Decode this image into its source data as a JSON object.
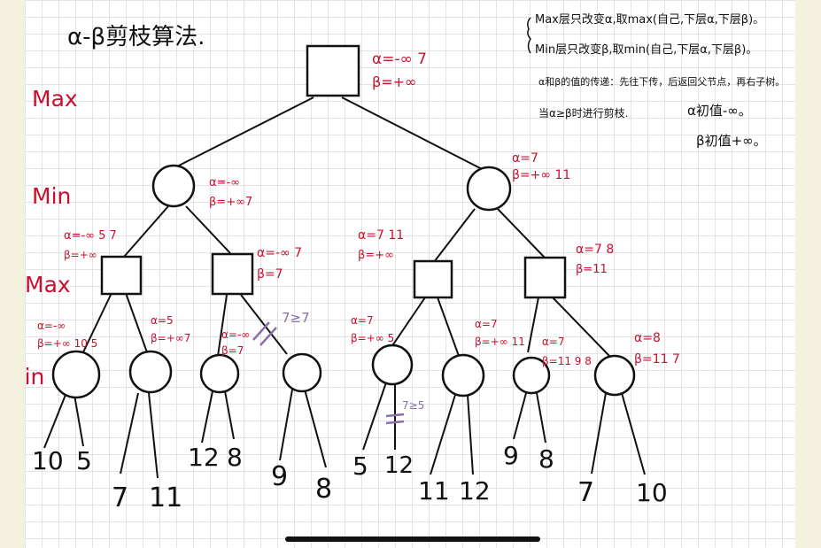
{
  "title": "α-β剪枝算法.",
  "notes": [
    "Max层只改变α,取max(自己,下层α,下层β)。",
    "Min层只改变β,取min(自己,下层α,下层β)。",
    "α和β的值的传递：先往下传，后返回父节点，再右子树。",
    "当α≥β时进行剪枝."
  ],
  "init_notes": [
    "α初值-∞。",
    "β初值+∞。"
  ],
  "levels": [
    "Max",
    "Min",
    "Max",
    "Min"
  ],
  "root_ab": [
    "α=-∞ 7",
    "β=+∞"
  ],
  "min1": [
    {
      "a": "α=-∞",
      "b": "β=+∞7"
    },
    {
      "a": "α=7",
      "b": "β=+∞ 11"
    }
  ],
  "max2": [
    {
      "a": "α=-∞ 5 7",
      "b": "β=+∞"
    },
    {
      "a": "α=-∞ 7",
      "b": "β=7"
    },
    {
      "a": "α=7 11",
      "b": "β=+∞"
    },
    {
      "a": "α=7 8",
      "b": "β=11"
    }
  ],
  "min3": [
    {
      "a": "α=-∞",
      "b": "β=+∞ 10 5"
    },
    {
      "a": "α=5",
      "b": "β=+∞7"
    },
    {
      "a": "α=-∞",
      "b": "β=7"
    },
    {
      "a": "",
      "b": ""
    },
    {
      "a": "α=7",
      "b": "β=+∞ 5"
    },
    {
      "a": "α=7",
      "b": "β=+∞ 11"
    },
    {
      "a": "α=7",
      "b": "β=11 9 8"
    },
    {
      "a": "α=8",
      "b": "β=11 7"
    }
  ],
  "prune_notes": [
    "7≥7",
    "7≥5"
  ],
  "leaves": [
    "10",
    "5",
    "7",
    "11",
    "12",
    "8",
    "9",
    "8",
    "5",
    "12",
    "11",
    "12",
    "9",
    "8",
    "7",
    "10"
  ]
}
